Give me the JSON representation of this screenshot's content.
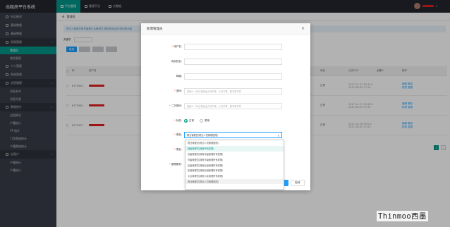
{
  "app": {
    "title": "出租房平台系统"
  },
  "topnav": [
    {
      "label": "平台管理",
      "active": true
    },
    {
      "label": "管理平台",
      "active": false
    },
    {
      "label": "大数据",
      "active": false
    }
  ],
  "sidebar": {
    "items": [
      {
        "label": "社区概况",
        "type": "item"
      },
      {
        "label": "基础数据",
        "type": "item"
      },
      {
        "label": "基础数据",
        "type": "item"
      },
      {
        "label": "权限管理",
        "type": "parent"
      },
      {
        "label": "管理员",
        "type": "sub",
        "active": true
      },
      {
        "label": "角色管理",
        "type": "sub"
      },
      {
        "label": "个人管理",
        "type": "item"
      },
      {
        "label": "系统管理",
        "type": "item"
      },
      {
        "label": "消息管理",
        "type": "parent"
      },
      {
        "label": "消息发布",
        "type": "sub"
      },
      {
        "label": "消息列表",
        "type": "sub"
      },
      {
        "label": "数据统计",
        "type": "parent"
      },
      {
        "label": "出租概况",
        "type": "sub"
      },
      {
        "label": "户籍统计",
        "type": "sub"
      },
      {
        "label": "TP 统计",
        "type": "sub"
      },
      {
        "label": "门禁数据统计",
        "type": "sub"
      },
      {
        "label": "户籍数据统计",
        "type": "sub"
      },
      {
        "label": "出租户",
        "type": "parent"
      },
      {
        "label": "户籍统计",
        "type": "sub"
      },
      {
        "label": "户籍统计",
        "type": "sub"
      }
    ]
  },
  "main": {
    "page_title": "管理员",
    "notice": "提示1:管理员账号管理平台管理员,提供账号启用/禁用等功能",
    "filter_label": "关键字",
    "buttons": [
      "新增",
      "",
      "",
      ""
    ],
    "table": {
      "headers": [
        "",
        "序",
        "用户名",
        "姓名",
        "",
        "",
        "",
        "",
        "状态",
        "创建时间",
        "创建人",
        "操作"
      ],
      "rows": [
        {
          "id": "6771910",
          "state": "正常",
          "time": "2017-11-07 09:30:0\n2017-06-09 17:53",
          "ops": "编辑 删除\n权限 重置"
        },
        {
          "id": "6771930",
          "state": "正常",
          "time": "2017-11-17 09:40:0\n2017-06-09 17:53",
          "ops": "编辑 删除\n权限 重置"
        },
        {
          "id": "6771979",
          "state": "正常",
          "time": "2017-10-26 09:0:0\n2017-06-09 17:53",
          "ops": "编辑 删除\n权限 重置"
        }
      ]
    },
    "pager": {
      "current": "1",
      "total": "1"
    }
  },
  "modal": {
    "title": "新增管理员",
    "close_icon": "close-icon",
    "fields": {
      "username": {
        "label": "用户名:",
        "required": true,
        "placeholder": ""
      },
      "realname": {
        "label": "真实姓名:",
        "required": false,
        "placeholder": ""
      },
      "phone": {
        "label": "邮箱:",
        "required": false,
        "placeholder": ""
      },
      "password": {
        "label": "密码:",
        "required": true,
        "placeholder": "密码6~16位,需包含大写字母、小写字母、数字和字符"
      },
      "password2": {
        "label": "二次密码:",
        "required": true,
        "placeholder": "密码6~16位,需包含大写字母、小写字母、数字和字符"
      },
      "status": {
        "label": "状态:",
        "required": true,
        "options": [
          "正常",
          "禁用"
        ],
        "selected": "正常"
      },
      "role": {
        "label": "角色:",
        "required": true,
        "value": "物业管理员(物业人员管理权限)"
      },
      "area": {
        "label": "角色:",
        "required": true
      },
      "manage": {
        "label": "管理服务:",
        "required": true
      }
    },
    "role_options": [
      {
        "label": "物业管理员(物业人员管理权限)",
        "state": "normal"
      },
      {
        "label": "超级管理员(拥有所有权限)",
        "state": "selected"
      },
      {
        "label": "省级管理员(拥有省级管理所有权限)",
        "state": "normal"
      },
      {
        "label": "市级管理员(拥有市级管理所有权限)",
        "state": "normal"
      },
      {
        "label": "区级管理员(拥有区级管理所有权限)",
        "state": "normal"
      },
      {
        "label": "街道管理员(拥有街道管理所有权限)",
        "state": "normal"
      },
      {
        "label": "小区管理员(拥有小区管理所有权限)",
        "state": "normal"
      },
      {
        "label": "物业管理员(物业人员管理权限)",
        "state": "hover"
      }
    ],
    "ok_label": "确定",
    "cancel_label": "取消"
  },
  "watermark": "Thinmoo西墨"
}
